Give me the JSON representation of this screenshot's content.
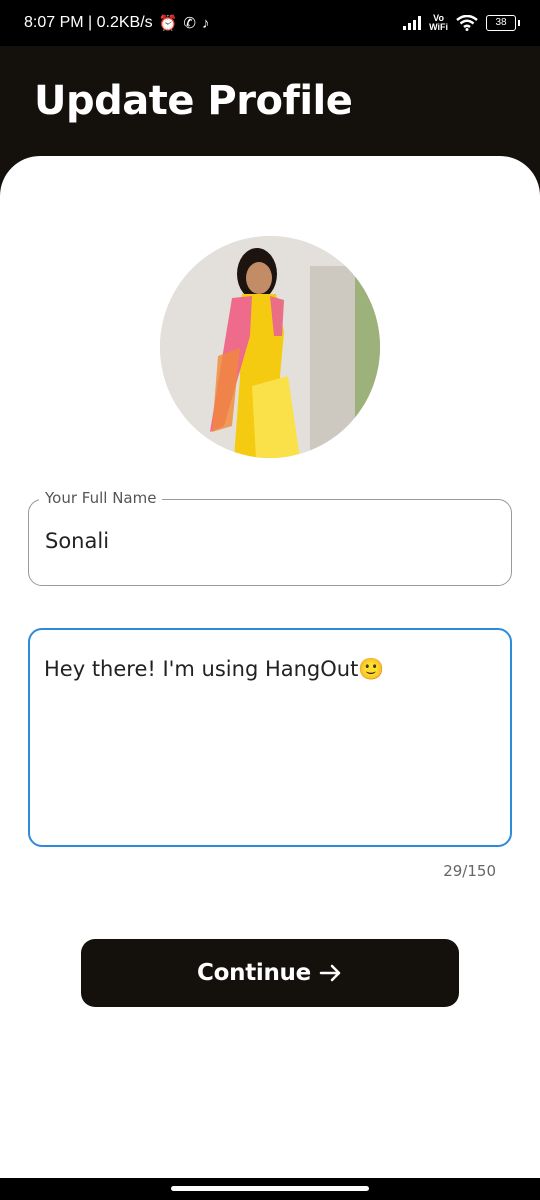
{
  "status_bar": {
    "time_speed": "8:07 PM | 0.2KB/s",
    "icons": [
      "alarm-icon",
      "whatsapp-icon",
      "tiktok-icon"
    ],
    "vowifi_top": "Vo",
    "vowifi_bottom": "WiFi",
    "battery": "38"
  },
  "header": {
    "title": "Update Profile"
  },
  "profile": {
    "avatar_icon": "profile-photo"
  },
  "name_field": {
    "label": "Your Full Name",
    "value": "Sonali"
  },
  "bio_field": {
    "value": "Hey there! I'm using HangOut🙂"
  },
  "counter": "29/150",
  "continue_button": {
    "label": "Continue",
    "icon": "arrow-right-icon"
  },
  "colors": {
    "dark": "#14100c",
    "focus": "#2e8bdc",
    "border": "#9a9a9a"
  }
}
